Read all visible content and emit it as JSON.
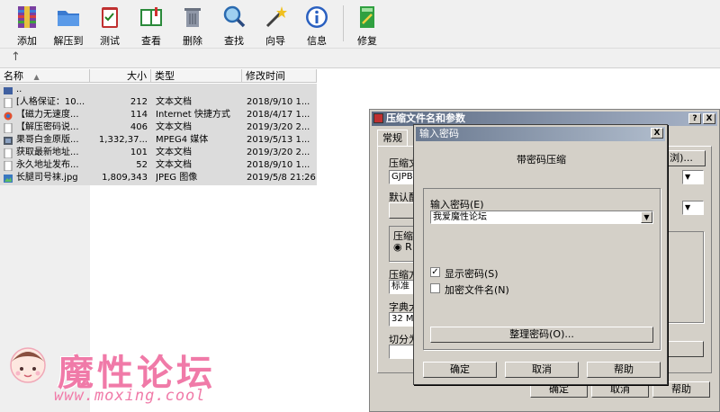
{
  "toolbar": {
    "buttons": [
      {
        "label": "添加",
        "icon": "archive-add-icon"
      },
      {
        "label": "解压到",
        "icon": "folder-extract-icon"
      },
      {
        "label": "测试",
        "icon": "clipboard-test-icon"
      },
      {
        "label": "查看",
        "icon": "book-view-icon"
      },
      {
        "label": "删除",
        "icon": "trash-icon"
      },
      {
        "label": "查找",
        "icon": "magnifier-icon"
      },
      {
        "label": "向导",
        "icon": "wand-icon"
      },
      {
        "label": "信息",
        "icon": "info-icon"
      },
      {
        "label": "修复",
        "icon": "repair-book-icon"
      }
    ]
  },
  "pathbar": {
    "up_glyph": "↑"
  },
  "filelist": {
    "columns": {
      "name": "名称",
      "size": "大小",
      "type": "类型",
      "modified": "修改时间"
    },
    "rows": [
      {
        "name": "..",
        "size": "",
        "type": "",
        "modified": ""
      },
      {
        "name": "[人格保证：10...",
        "size": "212",
        "type": "文本文档",
        "modified": "2018/9/10 1..."
      },
      {
        "name": "【磁力无速度...",
        "size": "114",
        "type": "Internet 快捷方式",
        "modified": "2018/4/17 1..."
      },
      {
        "name": "【解压密码说...",
        "size": "406",
        "type": "文本文档",
        "modified": "2019/3/20 2..."
      },
      {
        "name": "果哥白金原版...",
        "size": "1,332,37...",
        "type": "MPEG4 媒体",
        "modified": "2019/5/13 1..."
      },
      {
        "name": "获取最新地址...",
        "size": "101",
        "type": "文本文档",
        "modified": "2019/3/20 2..."
      },
      {
        "name": "永久地址发布...",
        "size": "52",
        "type": "文本文档",
        "modified": "2018/9/10 1..."
      },
      {
        "name": "长腿司号袜.jpg",
        "size": "1,809,343",
        "type": "JPEG 图像",
        "modified": "2019/5/8 21:26"
      }
    ]
  },
  "archive_dialog": {
    "title": "压缩文件名和参数",
    "help_glyph": "?",
    "close_glyph": "X",
    "tab_general": "常规",
    "archive_name_label": "压缩文",
    "archive_name_value": "GJPBH",
    "browse_label": "浏)...",
    "default_profile_label": "默认配",
    "format_label": "压缩",
    "format_value": "R",
    "method_label": "压缩方",
    "method_value": "标准",
    "dict_label": "字典大",
    "dict_value": "32 MB",
    "split_label": "切分为",
    "ok": "确定",
    "cancel": "取消",
    "help": "帮助"
  },
  "password_dialog": {
    "title": "输入密码",
    "close_glyph": "X",
    "heading": "带密码压缩",
    "password_label": "输入密码(E)",
    "password_value": "我爱魔性论坛",
    "show_password_label": "显示密码(S)",
    "show_password_checked": true,
    "encrypt_names_label": "加密文件名(N)",
    "encrypt_names_checked": false,
    "organize_button": "整理密码(O)...",
    "ok": "确定",
    "cancel": "取消",
    "help": "帮助"
  },
  "watermark": {
    "title": "魔性论坛",
    "url": "www.moxing.cool"
  },
  "colors": {
    "title_gradient_start": "#5b6a82",
    "watermark_pink": "#f07aa8",
    "dialog_face": "#d4d0c8"
  }
}
